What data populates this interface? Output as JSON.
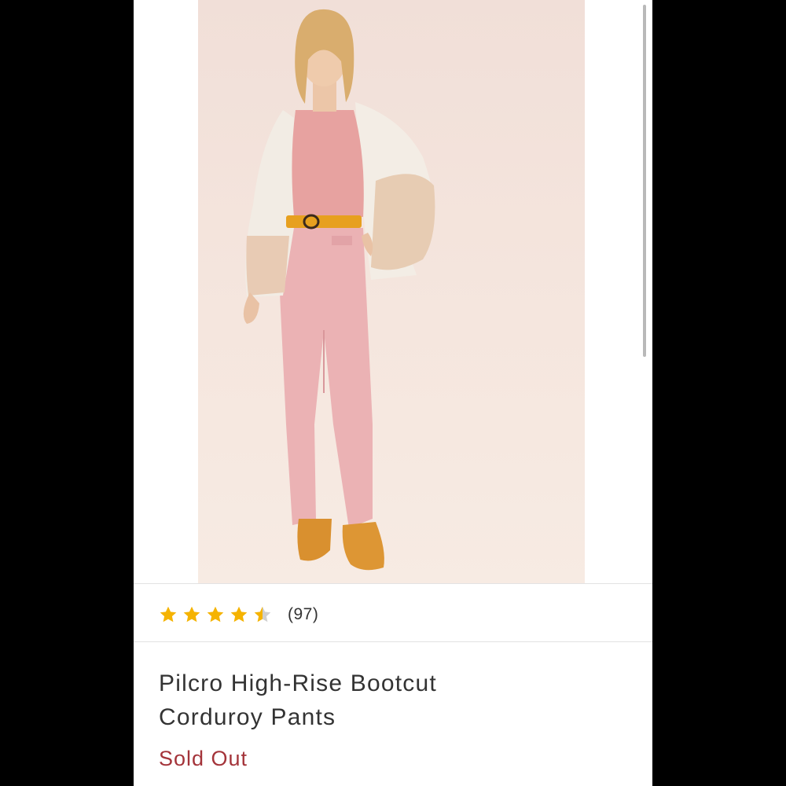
{
  "product": {
    "image_alt": "Model wearing pink corduroy bootcut pants with a faux fur coat",
    "rating": {
      "value": 4.5,
      "max": 5,
      "count_label": "(97)",
      "star_color": "#f5b301",
      "empty_star_color": "#cfcfcf"
    },
    "title_line1": "Pilcro High-Rise Bootcut",
    "title_line2": "Corduroy Pants",
    "status": "Sold Out",
    "status_color": "#a4343a"
  }
}
